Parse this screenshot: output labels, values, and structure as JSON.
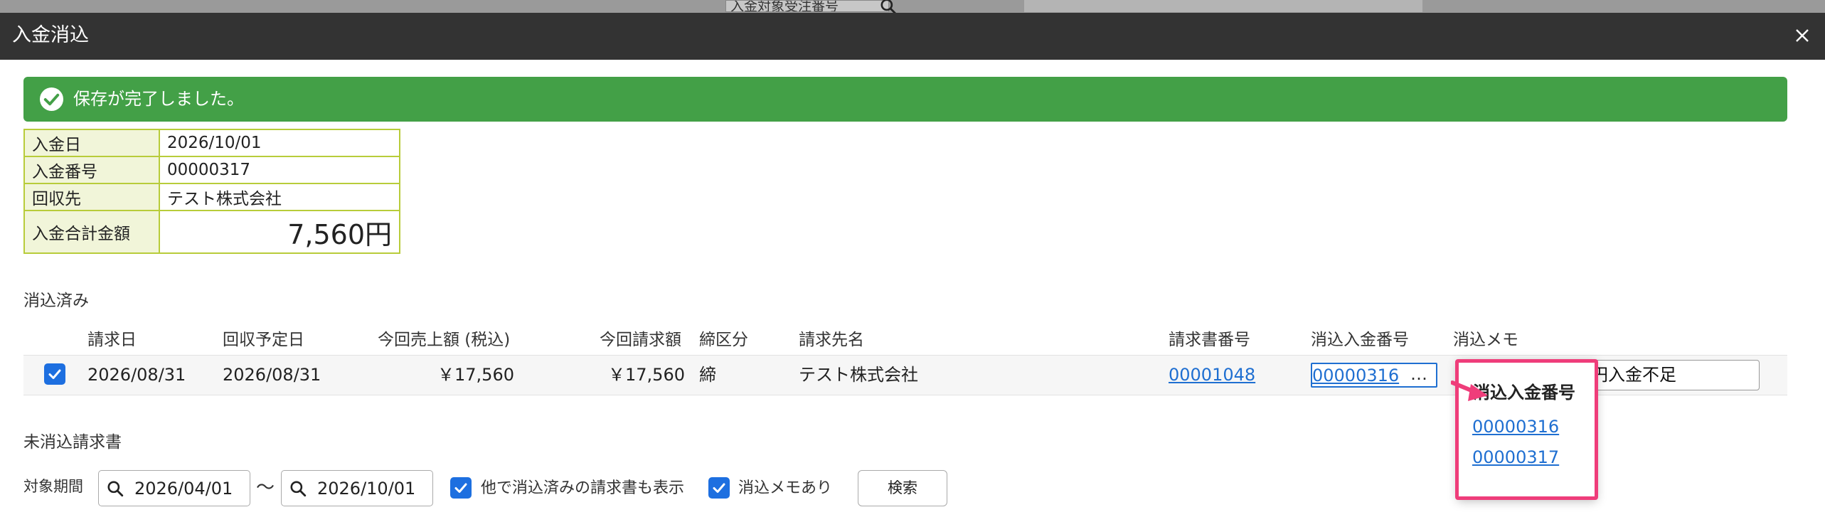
{
  "background": {
    "field_text": "入金対象受注番号"
  },
  "modal": {
    "title": "入金消込",
    "alert": {
      "message": "保存が完了しました。",
      "color": "#43a047"
    },
    "info": {
      "deposit_date_label": "入金日",
      "deposit_date": "2026/10/01",
      "deposit_no_label": "入金番号",
      "deposit_no": "00000317",
      "customer_label": "回収先",
      "customer": "テスト株式会社",
      "total_label": "入金合計金額",
      "total": "7,560円"
    },
    "applied": {
      "section_label": "消込済み",
      "headers": [
        "請求日",
        "回収予定日",
        "今回売上額 (税込)",
        "今回請求額",
        "締区分",
        "請求先名",
        "請求書番号",
        "消込入金番号",
        "消込メモ"
      ],
      "row": {
        "checked": true,
        "invoice_date": "2026/08/31",
        "due_date": "2026/08/31",
        "sales_amount": "￥17,560",
        "invoice_amount": "￥17,560",
        "closing_type": "締",
        "billing_name": "テスト株式会社",
        "invoice_no": "00001048",
        "deposit_no": "00000316",
        "deposit_no_more": "…",
        "memo": "円入金不足"
      }
    },
    "popup": {
      "title": "消込入金番号",
      "items": [
        "00000316",
        "00000317"
      ]
    },
    "unapplied": {
      "section_label": "未消込請求書",
      "filter_label": "対象期間",
      "date_from": "2026/04/01",
      "tilde": "〜",
      "date_to": "2026/10/01",
      "show_others_label": "他で消込済みの請求書も表示",
      "has_memo_label": "消込メモあり",
      "search_button": "検索"
    },
    "accent_color": "#1d6fe0",
    "highlight_color": "#ef3d7a"
  }
}
